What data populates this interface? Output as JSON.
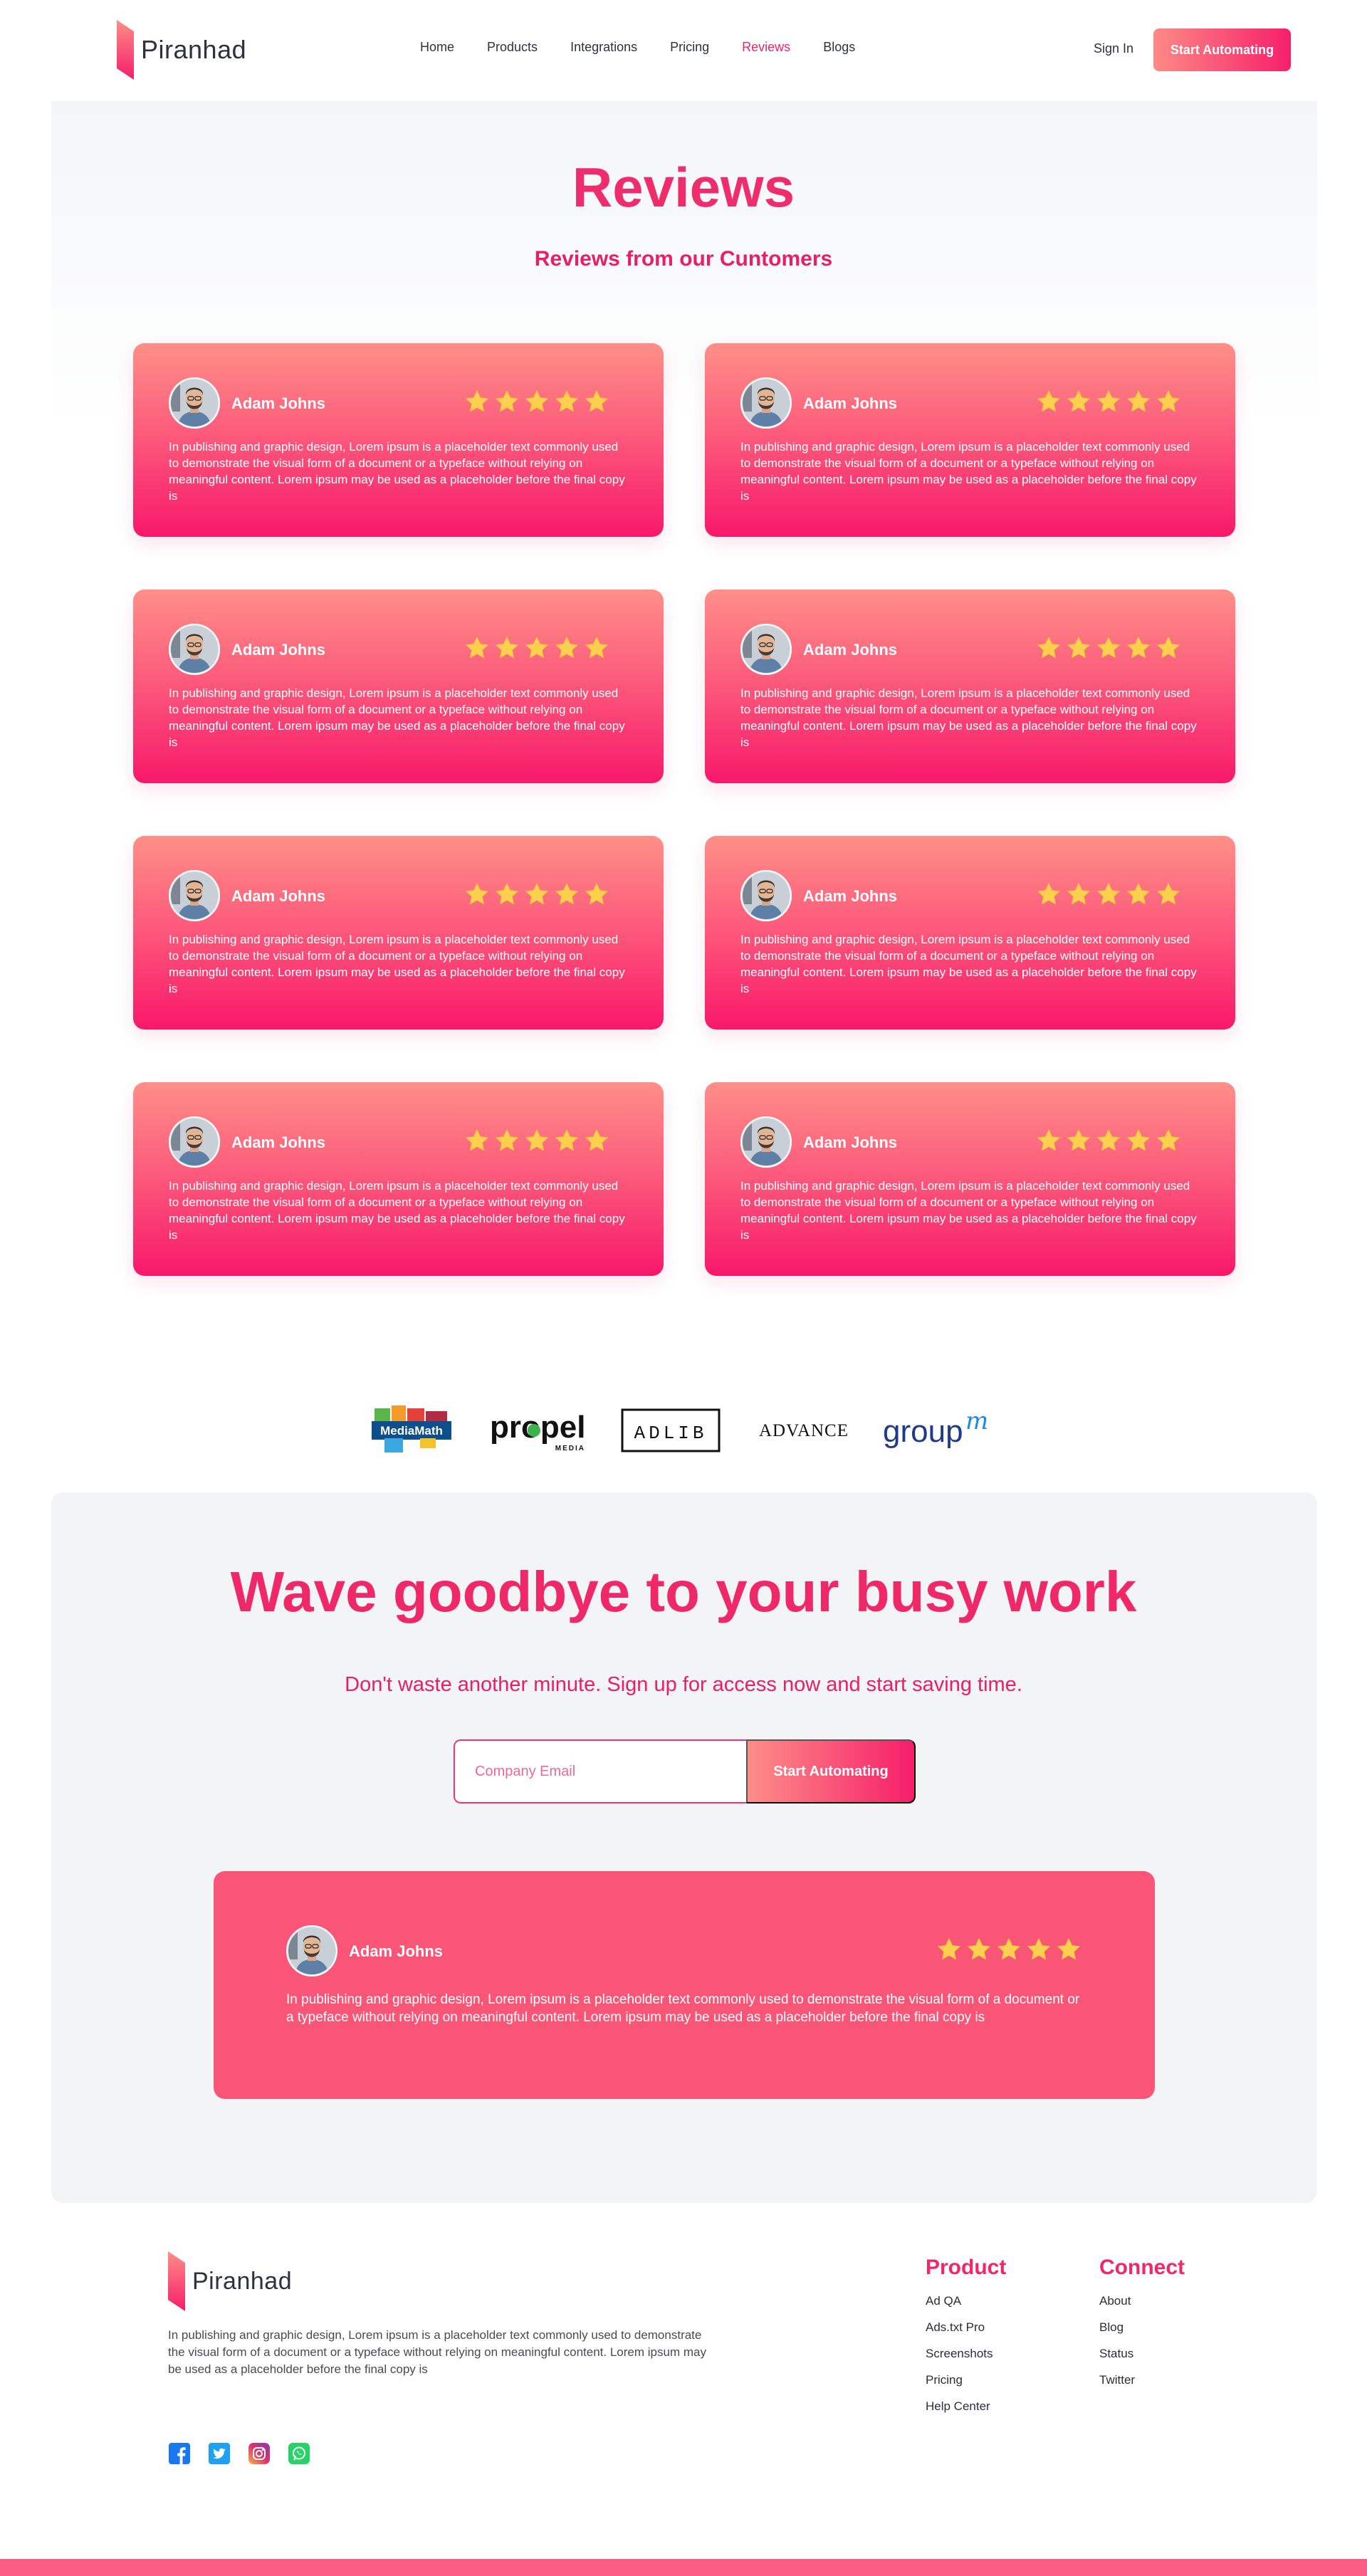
{
  "brand": {
    "name": "Piranhad"
  },
  "nav": {
    "items": [
      {
        "label": "Home",
        "active": false
      },
      {
        "label": "Products",
        "active": false
      },
      {
        "label": "Integrations",
        "active": false
      },
      {
        "label": "Pricing",
        "active": false
      },
      {
        "label": "Reviews",
        "active": true
      },
      {
        "label": "Blogs",
        "active": false
      }
    ],
    "signin_label": "Sign In",
    "cta_label": "Start Automating"
  },
  "reviews": {
    "title": "Reviews",
    "subtitle": "Reviews from our Cuntomers",
    "cards": [
      {
        "name": "Adam Johns",
        "rating": 5,
        "text": "In publishing and graphic design, Lorem ipsum is a placeholder text commonly used to demonstrate the visual form of a document or a typeface without relying on meaningful content. Lorem ipsum may be used as a placeholder before the final copy is"
      },
      {
        "name": "Adam Johns",
        "rating": 5,
        "text": "In publishing and graphic design, Lorem ipsum is a placeholder text commonly used to demonstrate the visual form of a document or a typeface without relying on meaningful content. Lorem ipsum may be used as a placeholder before the final copy is"
      },
      {
        "name": "Adam Johns",
        "rating": 5,
        "text": "In publishing and graphic design, Lorem ipsum is a placeholder text commonly used to demonstrate the visual form of a document or a typeface without relying on meaningful content. Lorem ipsum may be used as a placeholder before the final copy is"
      },
      {
        "name": "Adam Johns",
        "rating": 5,
        "text": "In publishing and graphic design, Lorem ipsum is a placeholder text commonly used to demonstrate the visual form of a document or a typeface without relying on meaningful content. Lorem ipsum may be used as a placeholder before the final copy is"
      },
      {
        "name": "Adam Johns",
        "rating": 5,
        "text": "In publishing and graphic design, Lorem ipsum is a placeholder text commonly used to demonstrate the visual form of a document or a typeface without relying on meaningful content. Lorem ipsum may be used as a placeholder before the final copy is"
      },
      {
        "name": "Adam Johns",
        "rating": 5,
        "text": "In publishing and graphic design, Lorem ipsum is a placeholder text commonly used to demonstrate the visual form of a document or a typeface without relying on meaningful content. Lorem ipsum may be used as a placeholder before the final copy is"
      },
      {
        "name": "Adam Johns",
        "rating": 5,
        "text": "In publishing and graphic design, Lorem ipsum is a placeholder text commonly used to demonstrate the visual form of a document or a typeface without relying on meaningful content. Lorem ipsum may be used as a placeholder before the final copy is"
      },
      {
        "name": "Adam Johns",
        "rating": 5,
        "text": "In publishing and graphic design, Lorem ipsum is a placeholder text commonly used to demonstrate the visual form of a document or a typeface without relying on meaningful content. Lorem ipsum may be used as a placeholder before the final copy is"
      }
    ]
  },
  "brands": [
    {
      "id": "mediamath-logo",
      "label": "MediaMath"
    },
    {
      "id": "propel-logo",
      "label": "propel",
      "sub": "MEDIA"
    },
    {
      "id": "adlib-logo",
      "label": "ADLIB"
    },
    {
      "id": "advance-logo",
      "label": "ADVANCE"
    },
    {
      "id": "groupm-logo",
      "label": "group",
      "accent": "m"
    }
  ],
  "cta": {
    "title": "Wave goodbye to your busy work",
    "subtitle": "Don't waste another minute. Sign up for access now and start saving time.",
    "email_placeholder": "Company Email",
    "button_label": "Start Automating"
  },
  "featured_review": {
    "name": "Adam Johns",
    "rating": 5,
    "text": "In publishing and graphic design, Lorem ipsum is a placeholder text commonly used to demonstrate the visual form of a document or a typeface without relying on meaningful content. Lorem ipsum may be used as a placeholder before the final copy is"
  },
  "footer": {
    "brand": "Piranhad",
    "description": "In publishing and graphic design, Lorem ipsum is a placeholder text commonly used to demonstrate the visual form of a document or a typeface without relying on meaningful content. Lorem ipsum may be used as a placeholder before the final copy is",
    "product": {
      "title": "Product",
      "links": [
        "Ad QA",
        "Ads.txt Pro",
        "Screenshots",
        "Pricing",
        "Help Center"
      ]
    },
    "connect": {
      "title": "Connect",
      "links": [
        "About",
        "Blog",
        "Status",
        "Twitter"
      ]
    },
    "social": [
      "facebook-icon",
      "twitter-icon",
      "instagram-icon",
      "whatsapp-icon"
    ]
  },
  "colors": {
    "accent": "#ef2868",
    "card_top": "#fe8f87",
    "card_bottom": "#f8186a",
    "star": "#fcd04f",
    "featured_card": "#f95577"
  }
}
